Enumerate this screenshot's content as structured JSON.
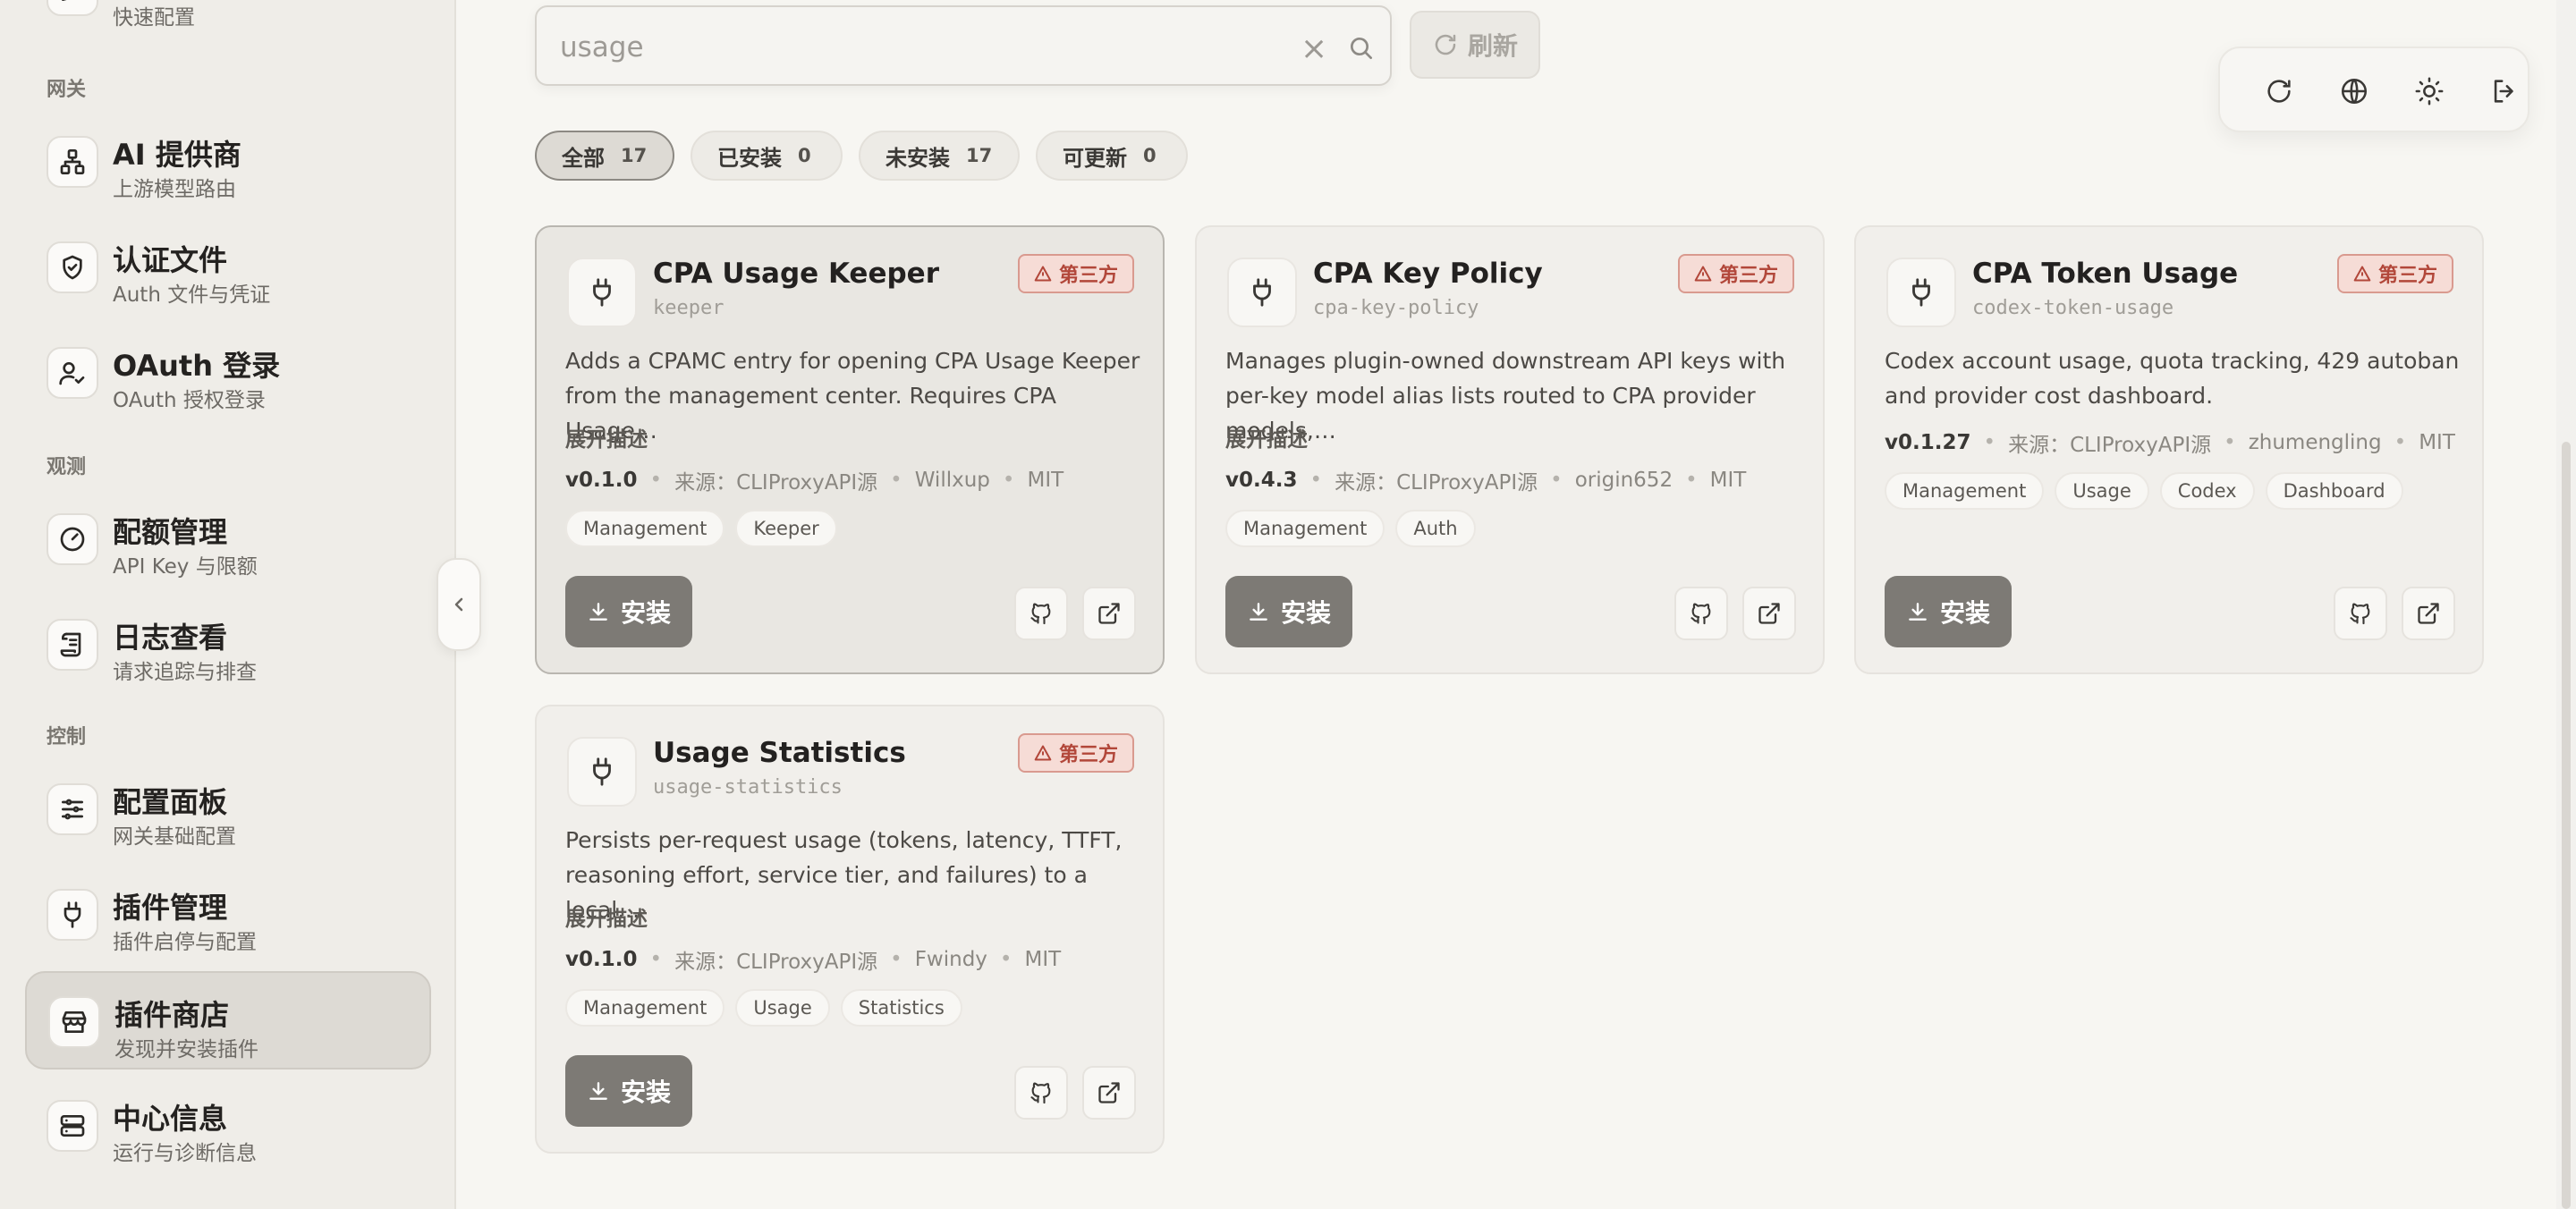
{
  "sidebar": {
    "top_partial": {
      "sub": "快速配置",
      "icon": "pencil-icon"
    },
    "sections": {
      "gateway": "网关",
      "observe": "观测",
      "control": "控制"
    },
    "items": [
      {
        "title": "AI 提供商",
        "sub": "上游模型路由",
        "icon": "network-icon"
      },
      {
        "title": "认证文件",
        "sub": "Auth 文件与凭证",
        "icon": "shield-icon"
      },
      {
        "title": "OAuth 登录",
        "sub": "OAuth 授权登录",
        "icon": "user-check-icon"
      },
      {
        "title": "配额管理",
        "sub": "API Key 与限额",
        "icon": "gauge-icon"
      },
      {
        "title": "日志查看",
        "sub": "请求追踪与排查",
        "icon": "scroll-icon"
      },
      {
        "title": "配置面板",
        "sub": "网关基础配置",
        "icon": "sliders-icon"
      },
      {
        "title": "插件管理",
        "sub": "插件启停与配置",
        "icon": "plug-icon"
      },
      {
        "title": "插件商店",
        "sub": "发现并安装插件",
        "icon": "store-icon",
        "active": true
      },
      {
        "title": "中心信息",
        "sub": "运行与诊断信息",
        "icon": "server-icon"
      }
    ]
  },
  "search": {
    "value": "usage",
    "placeholder": "usage"
  },
  "refresh_label": "刷新",
  "filters": [
    {
      "label": "全部",
      "count": "17",
      "active": true
    },
    {
      "label": "已安装",
      "count": "0"
    },
    {
      "label": "未安装",
      "count": "17"
    },
    {
      "label": "可更新",
      "count": "0"
    }
  ],
  "toolbar": [
    "refresh-icon",
    "globe-icon",
    "sun-icon",
    "logout-icon"
  ],
  "plugins": [
    {
      "title": "CPA Usage Keeper",
      "id": "keeper",
      "badge": "第三方",
      "desc": "Adds a CPAMC entry for opening CPA Usage Keeper from the management center. Requires CPA Usage…",
      "expand": "展开描述",
      "version": "v0.1.0",
      "source": "来源：CLIProxyAPI源",
      "author": "Willxup",
      "license": "MIT",
      "tags": [
        "Management",
        "Keeper"
      ],
      "install": "安装"
    },
    {
      "title": "CPA Key Policy",
      "id": "cpa-key-policy",
      "badge": "第三方",
      "desc": "Manages plugin-owned downstream API keys with per-key model alias lists routed to CPA provider models,…",
      "expand": "展开描述",
      "version": "v0.4.3",
      "source": "来源：CLIProxyAPI源",
      "author": "origin652",
      "license": "MIT",
      "tags": [
        "Management",
        "Auth"
      ],
      "install": "安装"
    },
    {
      "title": "CPA Token Usage",
      "id": "codex-token-usage",
      "badge": "第三方",
      "desc": "Codex account usage, quota tracking, 429 autoban and provider cost dashboard.",
      "expand": "",
      "version": "v0.1.27",
      "source": "来源：CLIProxyAPI源",
      "author": "zhumengling",
      "license": "MIT",
      "tags": [
        "Management",
        "Usage",
        "Codex",
        "Dashboard"
      ],
      "install": "安装"
    },
    {
      "title": "Usage Statistics",
      "id": "usage-statistics",
      "badge": "第三方",
      "desc": "Persists per-request usage (tokens, latency, TTFT, reasoning effort, service tier, and failures) to a local…",
      "expand": "展开描述",
      "version": "v0.1.0",
      "source": "来源：CLIProxyAPI源",
      "author": "Fwindy",
      "license": "MIT",
      "tags": [
        "Management",
        "Usage",
        "Statistics"
      ],
      "install": "安装"
    }
  ]
}
